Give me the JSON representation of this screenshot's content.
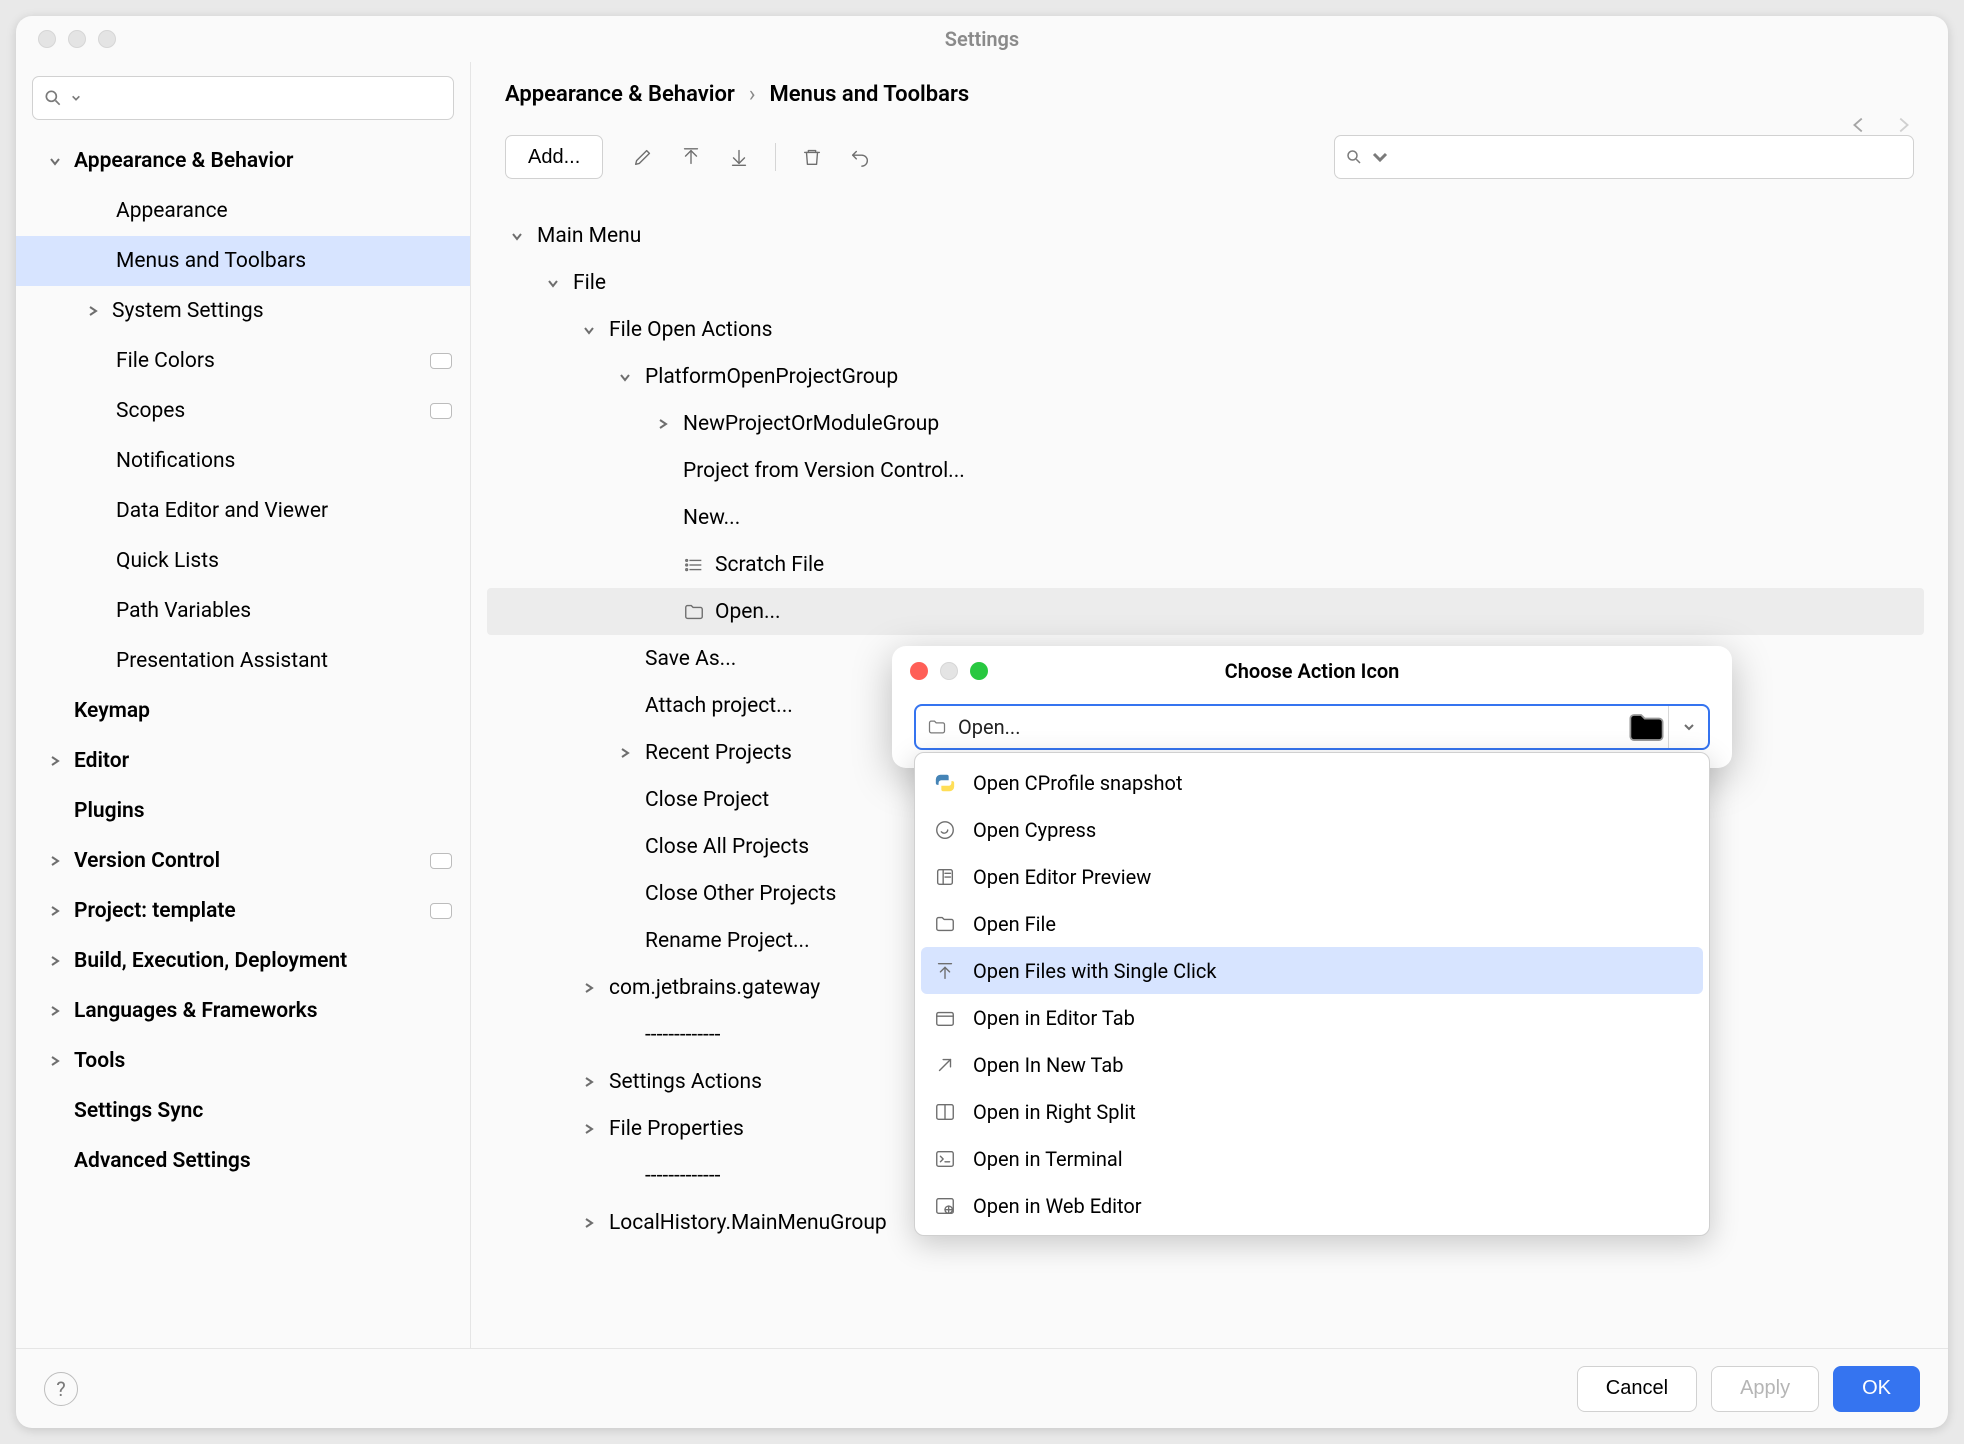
{
  "window": {
    "title": "Settings"
  },
  "sidebar": {
    "search_placeholder": "",
    "items": [
      {
        "label": "Appearance & Behavior",
        "bold": true,
        "indent": 0,
        "arrow": "down",
        "sel": false
      },
      {
        "label": "Appearance",
        "indent": 2,
        "arrow": "none"
      },
      {
        "label": "Menus and Toolbars",
        "indent": 2,
        "arrow": "none",
        "sel": true
      },
      {
        "label": "System Settings",
        "indent": 1,
        "arrow": "right"
      },
      {
        "label": "File Colors",
        "indent": 2,
        "arrow": "none",
        "chip": true
      },
      {
        "label": "Scopes",
        "indent": 2,
        "arrow": "none",
        "chip": true
      },
      {
        "label": "Notifications",
        "indent": 2,
        "arrow": "none"
      },
      {
        "label": "Data Editor and Viewer",
        "indent": 2,
        "arrow": "none"
      },
      {
        "label": "Quick Lists",
        "indent": 2,
        "arrow": "none"
      },
      {
        "label": "Path Variables",
        "indent": 2,
        "arrow": "none"
      },
      {
        "label": "Presentation Assistant",
        "indent": 2,
        "arrow": "none"
      },
      {
        "label": "Keymap",
        "bold": true,
        "indent": 0,
        "arrow": "blank"
      },
      {
        "label": "Editor",
        "bold": true,
        "indent": 0,
        "arrow": "right"
      },
      {
        "label": "Plugins",
        "bold": true,
        "indent": 0,
        "arrow": "blank"
      },
      {
        "label": "Version Control",
        "bold": true,
        "indent": 0,
        "arrow": "right",
        "chip": true
      },
      {
        "label": "Project: template",
        "bold": true,
        "indent": 0,
        "arrow": "right",
        "chip": true
      },
      {
        "label": "Build, Execution, Deployment",
        "bold": true,
        "indent": 0,
        "arrow": "right"
      },
      {
        "label": "Languages & Frameworks",
        "bold": true,
        "indent": 0,
        "arrow": "right"
      },
      {
        "label": "Tools",
        "bold": true,
        "indent": 0,
        "arrow": "right"
      },
      {
        "label": "Settings Sync",
        "bold": true,
        "indent": 0,
        "arrow": "blank"
      },
      {
        "label": "Advanced Settings",
        "bold": true,
        "indent": 0,
        "arrow": "blank"
      }
    ]
  },
  "breadcrumb": {
    "root": "Appearance & Behavior",
    "leaf": "Menus and Toolbars",
    "sep": "›"
  },
  "toolbar": {
    "add": "Add..."
  },
  "menutree": [
    {
      "label": "Main Menu",
      "indent": 1,
      "arrow": "down"
    },
    {
      "label": "File",
      "indent": 2,
      "arrow": "down"
    },
    {
      "label": "File Open Actions",
      "indent": 3,
      "arrow": "down"
    },
    {
      "label": "PlatformOpenProjectGroup",
      "indent": 4,
      "arrow": "down"
    },
    {
      "label": "NewProjectOrModuleGroup",
      "indent": 5,
      "arrow": "right"
    },
    {
      "label": "Project from Version Control...",
      "indent": 5,
      "arrow": "none"
    },
    {
      "label": "New...",
      "indent": 5,
      "arrow": "none"
    },
    {
      "label": "Scratch File",
      "indent": 5,
      "arrow": "none",
      "icon": "list"
    },
    {
      "label": "Open...",
      "indent": 5,
      "arrow": "none",
      "icon": "folder",
      "sel": true
    },
    {
      "label": "Save As...",
      "indent": 4,
      "arrow": "none"
    },
    {
      "label": "Attach project...",
      "indent": 4,
      "arrow": "none"
    },
    {
      "label": "Recent Projects",
      "indent": 4,
      "arrow": "right"
    },
    {
      "label": "Close Project",
      "indent": 4,
      "arrow": "none"
    },
    {
      "label": "Close All Projects",
      "indent": 4,
      "arrow": "none"
    },
    {
      "label": "Close Other Projects",
      "indent": 4,
      "arrow": "none"
    },
    {
      "label": "Rename Project...",
      "indent": 4,
      "arrow": "none"
    },
    {
      "label": "com.jetbrains.gateway",
      "indent": 3,
      "arrow": "right"
    },
    {
      "label": "-------------",
      "indent": 4,
      "arrow": "none"
    },
    {
      "label": "Settings Actions",
      "indent": 3,
      "arrow": "right"
    },
    {
      "label": "File Properties",
      "indent": 3,
      "arrow": "right"
    },
    {
      "label": "-------------",
      "indent": 4,
      "arrow": "none"
    },
    {
      "label": "LocalHistory.MainMenuGroup",
      "indent": 3,
      "arrow": "right"
    }
  ],
  "popup": {
    "title": "Choose Action Icon",
    "input_value": "Open...",
    "options": [
      {
        "label": "Open CProfile snapshot",
        "icon": "python"
      },
      {
        "label": " Open Cypress",
        "icon": "cypress"
      },
      {
        "label": "Open Editor Preview",
        "icon": "preview"
      },
      {
        "label": "Open File",
        "icon": "folder"
      },
      {
        "label": "Open Files with Single Click",
        "icon": "singleclick",
        "sel": true
      },
      {
        "label": "Open in Editor Tab",
        "icon": "tab"
      },
      {
        "label": "Open In New Tab",
        "icon": "newtab"
      },
      {
        "label": "Open in Right Split",
        "icon": "split"
      },
      {
        "label": "Open in Terminal",
        "icon": "terminal"
      },
      {
        "label": "Open in Web Editor",
        "icon": "web"
      }
    ]
  },
  "footer": {
    "cancel": "Cancel",
    "apply": "Apply",
    "ok": "OK"
  }
}
